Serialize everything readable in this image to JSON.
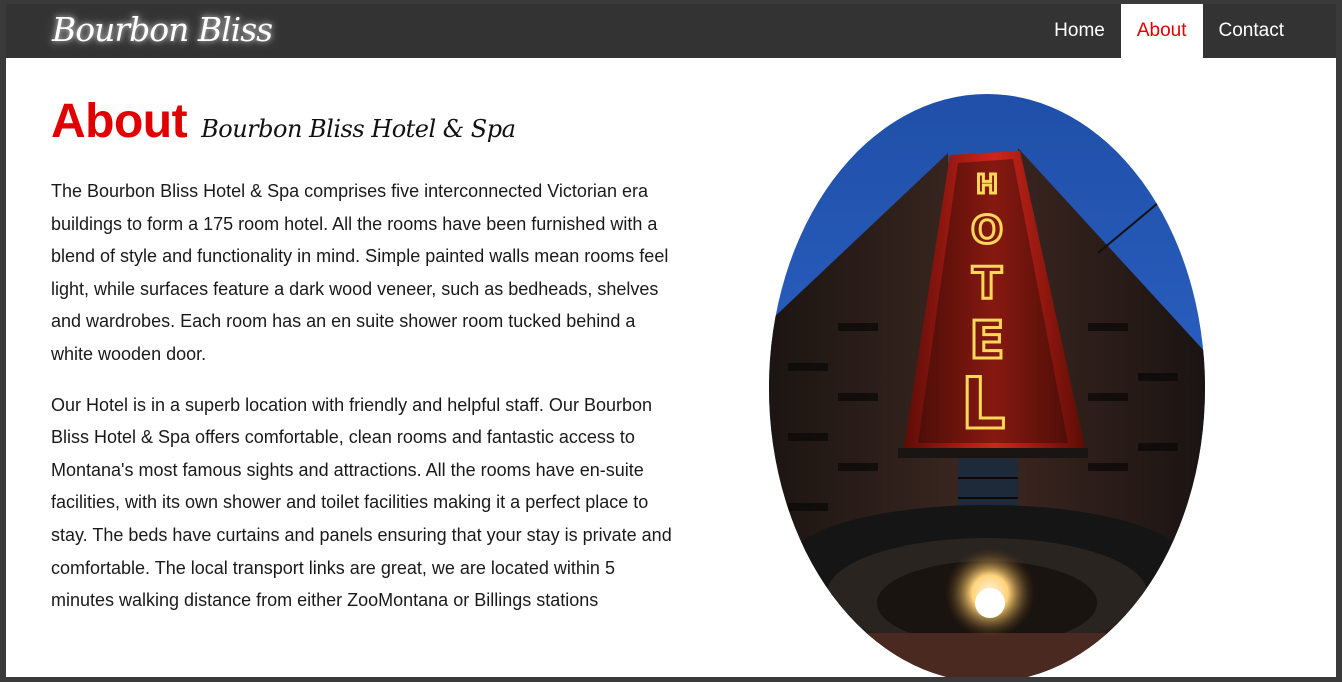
{
  "header": {
    "logo_text": "Bourbon Bliss",
    "nav": [
      {
        "label": "Home",
        "active": false
      },
      {
        "label": "About",
        "active": true
      },
      {
        "label": "Contact",
        "active": false
      }
    ]
  },
  "main": {
    "heading": "About",
    "subheading": "Bourbon Bliss Hotel & Spa",
    "paragraphs": [
      "The Bourbon Bliss Hotel & Spa comprises five interconnected Victorian era buildings to form a 175 room hotel. All the rooms have been furnished with a blend of style and functionality in mind. Simple painted walls mean rooms feel light, while surfaces feature a dark wood veneer, such as bedheads, shelves and wardrobes. Each room has an en suite shower room tucked behind a white wooden door.",
      "Our Hotel is in a superb location with friendly and helpful staff. Our Bourbon Bliss Hotel & Spa offers comfortable, clean rooms and fantastic access to Montana's most famous sights and attractions. All the rooms have en-suite facilities, with its own shower and toilet facilities making it a perfect place to stay. The beds have curtains and panels ensuring that your stay is private and comfortable. The local transport links are great, we are located within 5 minutes walking distance from either ZooMontana or Billings stations"
    ],
    "photo": {
      "sign_letters": [
        "H",
        "O",
        "T",
        "E",
        "L"
      ]
    }
  },
  "colors": {
    "accent": "#e00000",
    "navbar_bg": "#333333",
    "page_bg": "#ffffff"
  }
}
